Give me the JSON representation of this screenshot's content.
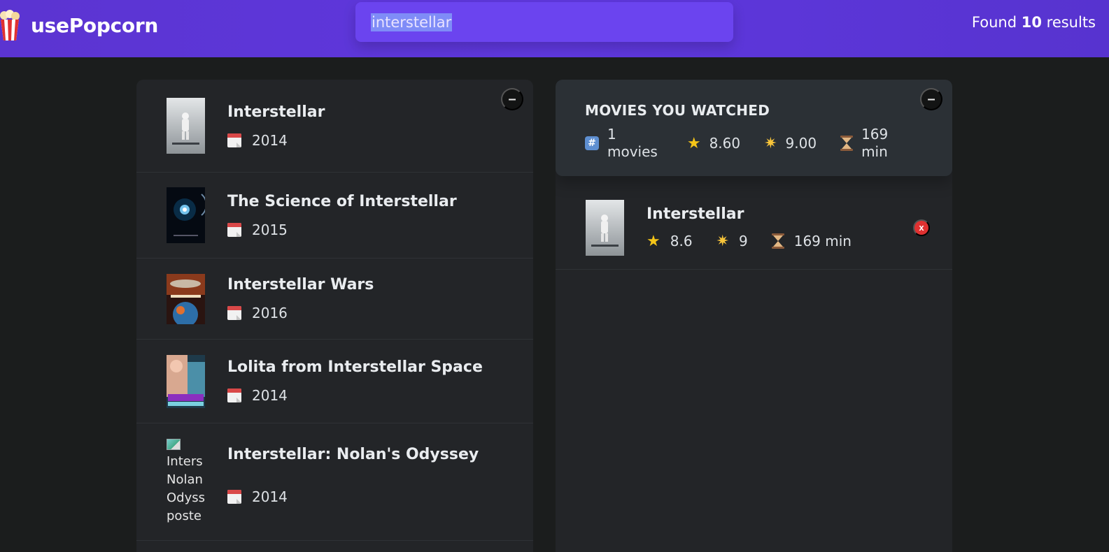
{
  "nav": {
    "logo_text": "usePopcorn",
    "logo_icon": "popcorn-icon",
    "search_value": "interstellar",
    "results_prefix": "Found",
    "results_count": "10",
    "results_suffix": "results"
  },
  "colors": {
    "nav_bg": "#5b34d1",
    "search_bg": "#6b44ef",
    "box_bg": "#232528",
    "summary_bg": "#2b3035",
    "delete": "#e03131"
  },
  "search_list": {
    "toggle_label": "–",
    "movies": [
      {
        "title": "Interstellar",
        "year": "2014",
        "poster": "poster-interstellar"
      },
      {
        "title": "The Science of Interstellar",
        "year": "2015",
        "poster": "poster-science"
      },
      {
        "title": "Interstellar Wars",
        "year": "2016",
        "poster": "poster-wars"
      },
      {
        "title": "Lolita from Interstellar Space",
        "year": "2014",
        "poster": "poster-lolita"
      },
      {
        "title": "Interstellar: Nolan's Odyssey",
        "year": "2014",
        "poster_alt": "Interstellar: Nolan's Odyssey poster",
        "poster_alt_visible": [
          "Inters",
          "Nolan",
          "Odyss",
          "poste"
        ]
      }
    ]
  },
  "watched": {
    "toggle_label": "–",
    "summary": {
      "title": "MOVIES YOU WATCHED",
      "count_line1": "1",
      "count_line2": "movies",
      "avg_imdb": "8.60",
      "avg_user": "9.00",
      "runtime_line1": "169",
      "runtime_line2": "min"
    },
    "movies": [
      {
        "title": "Interstellar",
        "imdb": "8.6",
        "user": "9",
        "runtime": "169 min",
        "delete_label": "x"
      }
    ]
  }
}
